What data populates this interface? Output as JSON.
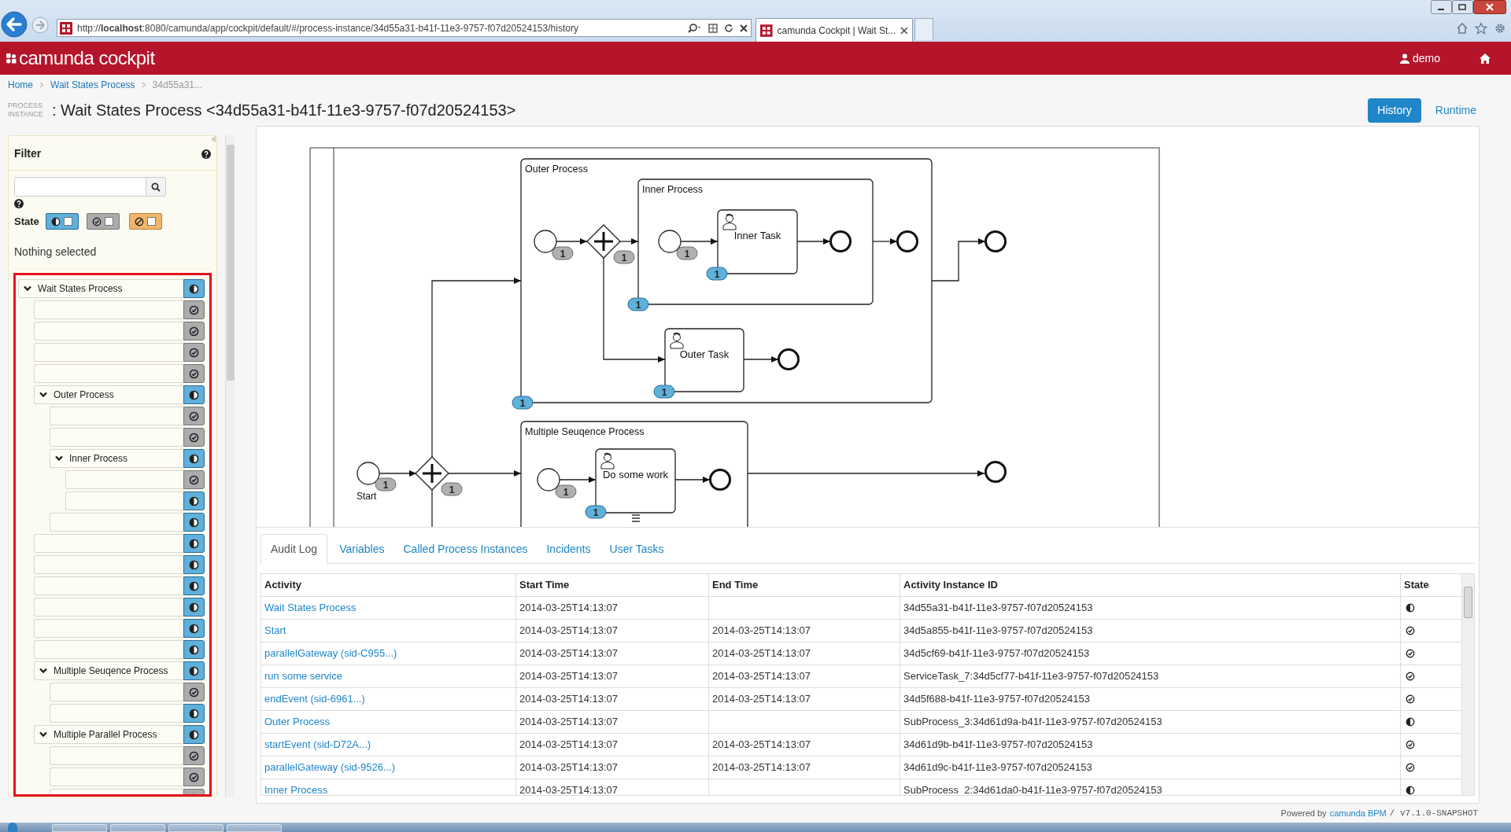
{
  "browser": {
    "url": "http://**localhost**:8080/camunda/app/cockpit/default/#/process-instance/34d55a31-b41f-11e3-9757-f07d20524153/history",
    "tab_title": "camunda Cockpit | Wait St..."
  },
  "header": {
    "brand": "camunda cockpit",
    "user": "demo"
  },
  "breadcrumb": [
    {
      "label": "Home",
      "current": false
    },
    {
      "label": "Wait States Process",
      "current": false
    },
    {
      "label": "34d55a31...",
      "current": true
    }
  ],
  "title": {
    "label": "PROCESS INSTANCE",
    "text": ": Wait States Process <34d55a31-b41f-11e3-9757-f07d20524153>"
  },
  "view_toggle": [
    {
      "label": "History",
      "selected": true
    },
    {
      "label": "Runtime",
      "selected": false
    }
  ],
  "filter": {
    "title": "Filter",
    "state_label": "State",
    "states": [
      {
        "kind": "running",
        "checked": false
      },
      {
        "kind": "completed",
        "checked": false
      },
      {
        "kind": "canceled",
        "checked": false
      }
    ],
    "selection": "Nothing selected"
  },
  "tree": [
    {
      "label": "Wait States Process",
      "kind": "running",
      "expanded": true,
      "children": [
        {
          "kind": "completed"
        },
        {
          "kind": "completed"
        },
        {
          "kind": "completed"
        },
        {
          "kind": "completed"
        },
        {
          "label": "Outer Process",
          "kind": "running",
          "expanded": true,
          "children": [
            {
              "kind": "completed"
            },
            {
              "kind": "completed"
            },
            {
              "label": "Inner Process",
              "kind": "running",
              "expanded": true,
              "children": [
                {
                  "kind": "completed"
                },
                {
                  "kind": "running"
                }
              ]
            },
            {
              "kind": "running"
            }
          ]
        },
        {
          "kind": "running"
        },
        {
          "kind": "running"
        },
        {
          "kind": "running"
        },
        {
          "kind": "running"
        },
        {
          "kind": "running"
        },
        {
          "kind": "running"
        },
        {
          "label": "Multiple Seuqence Process",
          "kind": "running",
          "expanded": true,
          "children": [
            {
              "kind": "completed"
            },
            {
              "kind": "running"
            }
          ]
        },
        {
          "label": "Multiple Parallel Process",
          "kind": "running",
          "expanded": true,
          "children": [
            {
              "kind": "completed"
            },
            {
              "kind": "completed"
            },
            {
              "kind": "completed"
            }
          ]
        }
      ]
    }
  ],
  "diagram": {
    "containers": [
      {
        "label": "Outer Process"
      },
      {
        "label": "Inner Process"
      },
      {
        "label": "Multiple Seuqence Process"
      }
    ],
    "tasks": [
      {
        "label": "Inner Task"
      },
      {
        "label": "Outer Task"
      },
      {
        "label": "Do some work"
      }
    ],
    "start_event_label": "Start",
    "badges": [
      {
        "count": "1",
        "kind": "completed"
      },
      {
        "count": "1",
        "kind": "completed"
      },
      {
        "count": "1",
        "kind": "completed"
      },
      {
        "count": "1",
        "kind": "completed"
      },
      {
        "count": "1",
        "kind": "completed"
      },
      {
        "count": "1",
        "kind": "completed"
      },
      {
        "count": "1",
        "kind": "running"
      },
      {
        "count": "1",
        "kind": "running"
      },
      {
        "count": "1",
        "kind": "running"
      },
      {
        "count": "1",
        "kind": "running"
      },
      {
        "count": "1",
        "kind": "running"
      }
    ]
  },
  "tabs": [
    {
      "label": "Audit Log",
      "selected": true
    },
    {
      "label": "Variables",
      "selected": false
    },
    {
      "label": "Called Process Instances",
      "selected": false
    },
    {
      "label": "Incidents",
      "selected": false
    },
    {
      "label": "User Tasks",
      "selected": false
    }
  ],
  "table": {
    "columns": [
      "Activity",
      "Start Time",
      "End Time",
      "Activity Instance ID",
      "State"
    ],
    "rows": [
      {
        "activity": "Wait States Process",
        "start_time": "2014-03-25T14:13:07",
        "instance_id": "34d55a31-b41f-11e3-9757-f07d20524153",
        "kind": "running"
      },
      {
        "activity": "Start",
        "start_time": "2014-03-25T14:13:07",
        "end_time": "2014-03-25T14:13:07",
        "instance_id": "34d5a855-b41f-11e3-9757-f07d20524153",
        "kind": "completed"
      },
      {
        "activity": "parallelGateway (sid-C955...)",
        "start_time": "2014-03-25T14:13:07",
        "end_time": "2014-03-25T14:13:07",
        "instance_id": "34d5cf69-b41f-11e3-9757-f07d20524153",
        "kind": "completed"
      },
      {
        "activity": "run some service",
        "start_time": "2014-03-25T14:13:07",
        "end_time": "2014-03-25T14:13:07",
        "instance_id": "ServiceTask_7:34d5cf77-b41f-11e3-9757-f07d20524153",
        "kind": "completed"
      },
      {
        "activity": "endEvent (sid-6961...)",
        "start_time": "2014-03-25T14:13:07",
        "end_time": "2014-03-25T14:13:07",
        "instance_id": "34d5f688-b41f-11e3-9757-f07d20524153",
        "kind": "completed"
      },
      {
        "activity": "Outer Process",
        "start_time": "2014-03-25T14:13:07",
        "instance_id": "SubProcess_3:34d61d9a-b41f-11e3-9757-f07d20524153",
        "kind": "running"
      },
      {
        "activity": "startEvent (sid-D72A...)",
        "start_time": "2014-03-25T14:13:07",
        "end_time": "2014-03-25T14:13:07",
        "instance_id": "34d61d9b-b41f-11e3-9757-f07d20524153",
        "kind": "completed"
      },
      {
        "activity": "parallelGateway (sid-9526...)",
        "start_time": "2014-03-25T14:13:07",
        "end_time": "2014-03-25T14:13:07",
        "instance_id": "34d61d9c-b41f-11e3-9757-f07d20524153",
        "kind": "completed"
      },
      {
        "activity": "Inner Process",
        "start_time": "2014-03-25T14:13:07",
        "instance_id": "SubProcess_2:34d61da0-b41f-11e3-9757-f07d20524153",
        "kind": "running"
      }
    ]
  },
  "footer": {
    "powered_by": "Powered by",
    "link": "camunda BPM",
    "version": "/ v7.1.0-SNAPSHOT"
  }
}
